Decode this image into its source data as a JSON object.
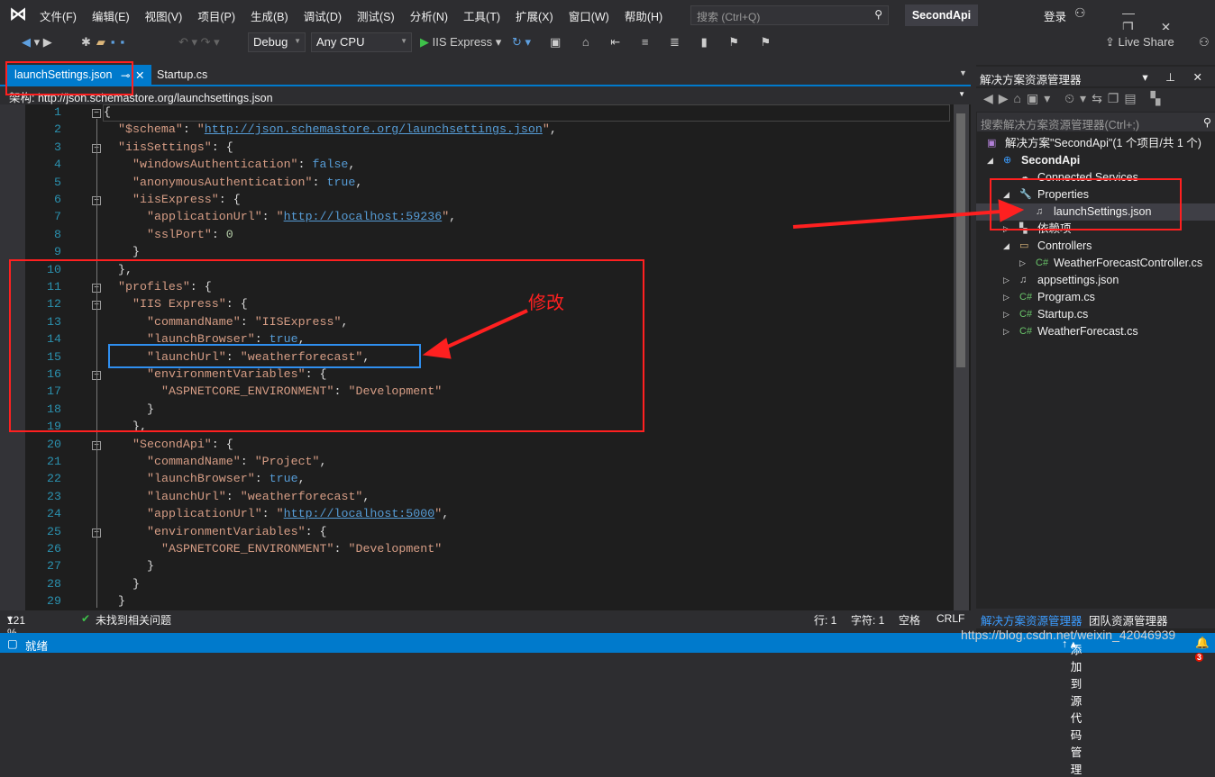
{
  "menubar": {
    "items": [
      "文件(F)",
      "编辑(E)",
      "视图(V)",
      "项目(P)",
      "生成(B)",
      "调试(D)",
      "测试(S)",
      "分析(N)",
      "工具(T)",
      "扩展(X)",
      "窗口(W)",
      "帮助(H)"
    ],
    "search_placeholder": "搜索 (Ctrl+Q)",
    "project": "SecondApi",
    "login": "登录"
  },
  "toolbar": {
    "config": "Debug",
    "platform": "Any CPU",
    "run": "IIS Express",
    "liveshare": "Live Share"
  },
  "tabs": [
    {
      "label": "launchSettings.json",
      "active": true
    },
    {
      "label": "Startup.cs",
      "active": false
    }
  ],
  "schema": {
    "label": "架构:",
    "url": "http://json.schemastore.org/launchsettings.json"
  },
  "editor": {
    "lines": [
      {
        "n": "1",
        "indent": 0,
        "text": "{"
      },
      {
        "n": "2",
        "indent": 1,
        "text": "\"$schema\": \"http://json.schemastore.org/launchsettings.json\","
      },
      {
        "n": "3",
        "indent": 1,
        "text": "\"iisSettings\": {"
      },
      {
        "n": "4",
        "indent": 2,
        "text": "\"windowsAuthentication\": false,"
      },
      {
        "n": "5",
        "indent": 2,
        "text": "\"anonymousAuthentication\": true,"
      },
      {
        "n": "6",
        "indent": 2,
        "text": "\"iisExpress\": {"
      },
      {
        "n": "7",
        "indent": 3,
        "text": "\"applicationUrl\": \"http://localhost:59236\","
      },
      {
        "n": "8",
        "indent": 3,
        "text": "\"sslPort\": 0"
      },
      {
        "n": "9",
        "indent": 2,
        "text": "}"
      },
      {
        "n": "10",
        "indent": 1,
        "text": "},"
      },
      {
        "n": "11",
        "indent": 1,
        "text": "\"profiles\": {"
      },
      {
        "n": "12",
        "indent": 2,
        "text": "\"IIS Express\": {"
      },
      {
        "n": "13",
        "indent": 3,
        "text": "\"commandName\": \"IISExpress\","
      },
      {
        "n": "14",
        "indent": 3,
        "text": "\"launchBrowser\": true,"
      },
      {
        "n": "15",
        "indent": 3,
        "text": "\"launchUrl\": \"weatherforecast\","
      },
      {
        "n": "16",
        "indent": 3,
        "text": "\"environmentVariables\": {"
      },
      {
        "n": "17",
        "indent": 4,
        "text": "\"ASPNETCORE_ENVIRONMENT\": \"Development\""
      },
      {
        "n": "18",
        "indent": 3,
        "text": "}"
      },
      {
        "n": "19",
        "indent": 2,
        "text": "},"
      },
      {
        "n": "20",
        "indent": 2,
        "text": "\"SecondApi\": {"
      },
      {
        "n": "21",
        "indent": 3,
        "text": "\"commandName\": \"Project\","
      },
      {
        "n": "22",
        "indent": 3,
        "text": "\"launchBrowser\": true,"
      },
      {
        "n": "23",
        "indent": 3,
        "text": "\"launchUrl\": \"weatherforecast\","
      },
      {
        "n": "24",
        "indent": 3,
        "text": "\"applicationUrl\": \"http://localhost:5000\","
      },
      {
        "n": "25",
        "indent": 3,
        "text": "\"environmentVariables\": {"
      },
      {
        "n": "26",
        "indent": 4,
        "text": "\"ASPNETCORE_ENVIRONMENT\": \"Development\""
      },
      {
        "n": "27",
        "indent": 3,
        "text": "}"
      },
      {
        "n": "28",
        "indent": 2,
        "text": "}"
      },
      {
        "n": "29",
        "indent": 1,
        "text": "}"
      }
    ],
    "fold_lines": [
      1,
      3,
      6,
      11,
      12,
      16,
      20,
      25
    ]
  },
  "editor_status": {
    "zoom": "121 %",
    "issues": "未找到相关问题",
    "line": "行: 1",
    "char": "字符: 1",
    "spaces": "空格",
    "eol": "CRLF"
  },
  "solution_explorer": {
    "title": "解决方案资源管理器",
    "search_placeholder": "搜索解决方案资源管理器(Ctrl+;)",
    "tree": [
      {
        "label": "解决方案\"SecondApi\"(1 个项目/共 1 个)",
        "level": 0,
        "arrow": "",
        "icon": "solution-icon"
      },
      {
        "label": "SecondApi",
        "level": 0,
        "arrow": "◢",
        "icon": "web-project-icon",
        "bold": true
      },
      {
        "label": "Connected Services",
        "level": 1,
        "arrow": "",
        "icon": "connected-services-icon"
      },
      {
        "label": "Properties",
        "level": 1,
        "arrow": "◢",
        "icon": "wrench-icon"
      },
      {
        "label": "launchSettings.json",
        "level": 2,
        "arrow": "",
        "icon": "json-file-icon",
        "selected": true
      },
      {
        "label": "依赖项",
        "level": 1,
        "arrow": "▷",
        "icon": "dependencies-icon"
      },
      {
        "label": "Controllers",
        "level": 1,
        "arrow": "◢",
        "icon": "folder-icon"
      },
      {
        "label": "WeatherForecastController.cs",
        "level": 2,
        "arrow": "▷",
        "icon": "csharp-icon"
      },
      {
        "label": "appsettings.json",
        "level": 1,
        "arrow": "▷",
        "icon": "json-file-icon"
      },
      {
        "label": "Program.cs",
        "level": 1,
        "arrow": "▷",
        "icon": "csharp-icon"
      },
      {
        "label": "Startup.cs",
        "level": 1,
        "arrow": "▷",
        "icon": "csharp-icon"
      },
      {
        "label": "WeatherForecast.cs",
        "level": 1,
        "arrow": "▷",
        "icon": "csharp-icon"
      }
    ],
    "bottom_tabs": [
      "解决方案资源管理器",
      "团队资源管理器"
    ]
  },
  "statusbar": {
    "ready": "就绪",
    "source_control": "添加到源代码管理",
    "watermark": "https://blog.csdn.net/weixin_42046939",
    "notifications": "3"
  },
  "annotation": {
    "text": "修改"
  },
  "colors": {
    "accent": "#007acc",
    "annotation_red": "#ff2020",
    "highlight_blue": "#2f8ff0"
  }
}
